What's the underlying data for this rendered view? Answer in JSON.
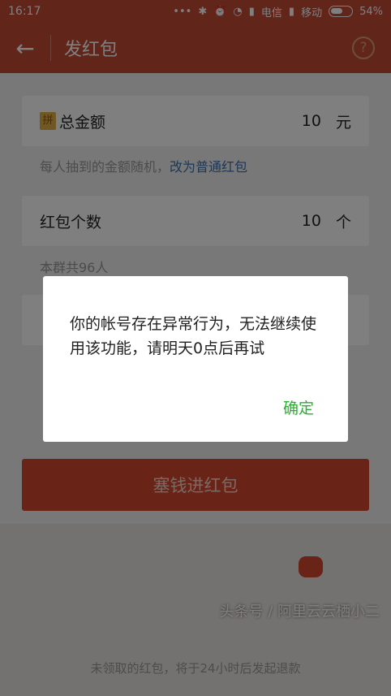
{
  "status_bar": {
    "time": "16:17",
    "carrier1": "电信",
    "carrier2": "移动",
    "battery": "54%",
    "icons": [
      "dots-icon",
      "bluetooth-icon",
      "alarm-icon",
      "wifi-icon",
      "signal-icon",
      "battery-icon"
    ]
  },
  "app_bar": {
    "back_icon": "←",
    "title": "发红包",
    "help_icon": "?"
  },
  "form": {
    "total_amount": {
      "icon": "拼",
      "label": "总金额",
      "value": "10",
      "unit": "元"
    },
    "amount_hint": "每人抽到的金额随机，",
    "amount_hint_link": "改为普通红包",
    "count": {
      "label": "红包个数",
      "value": "10",
      "unit": "个"
    },
    "count_hint": "本群共96人",
    "submit_label": "塞钱进红包"
  },
  "footer": {
    "note": "未领取的红包，将于24小时后发起退款",
    "watermark": "头条号 / 阿里云云栖小二"
  },
  "dialog": {
    "message": "你的帐号存在异常行为，无法继续使用该功能，请明天0点后再试",
    "ok_label": "确定"
  },
  "colors": {
    "brand_red": "#c44a34",
    "button_red": "#d4462f",
    "ok_green": "#2aae33",
    "link_blue": "#3a6fb0"
  }
}
